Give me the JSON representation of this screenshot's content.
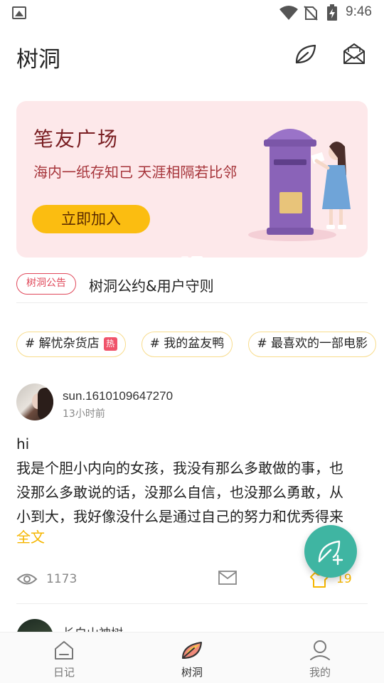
{
  "status_bar": {
    "time": "9:46",
    "icons": [
      "image-icon",
      "wifi-icon",
      "no-sim-icon",
      "battery-charging-icon"
    ]
  },
  "header": {
    "title": "树洞",
    "actions": [
      "leaf-icon",
      "mail-icon"
    ]
  },
  "banner": {
    "title": "笔友广场",
    "subtitle": "海内一纸存知己 天涯相隔若比邻",
    "button_label": "立即加入",
    "slide_count": 2,
    "active_slide": 2
  },
  "notice": {
    "tag": "树洞公告",
    "text": "树洞公约&用户守则"
  },
  "topics": [
    {
      "label": "# 解忧杂货店",
      "badge": "热"
    },
    {
      "label": "# 我的盆友鸭",
      "badge": ""
    },
    {
      "label": "# 最喜欢的一部电影",
      "badge": ""
    }
  ],
  "post": {
    "username": "sun.1610109647270",
    "time": "13小时前",
    "lines": [
      "hi",
      "我是个胆小内向的女孩，我没有那么多敢做的事，也",
      "没那么多敢说的话，没那么自信，也没那么勇敢，从",
      "小到大，我好像没什么是通过自己的努力和优秀得来"
    ],
    "more_label": "全文",
    "views": "1173",
    "likes": "19"
  },
  "next_post": {
    "username": "长白山神树"
  },
  "bottom_nav": [
    {
      "label": "日记",
      "icon": "home-icon",
      "active": false
    },
    {
      "label": "树洞",
      "icon": "leaf-icon",
      "active": true
    },
    {
      "label": "我的",
      "icon": "user-icon",
      "active": false
    }
  ],
  "colors": {
    "accent_yellow": "#fbbd11",
    "fab_teal": "#3fb5a2",
    "banner_bg": "#fde8ea",
    "notice_red": "#e0485a"
  }
}
